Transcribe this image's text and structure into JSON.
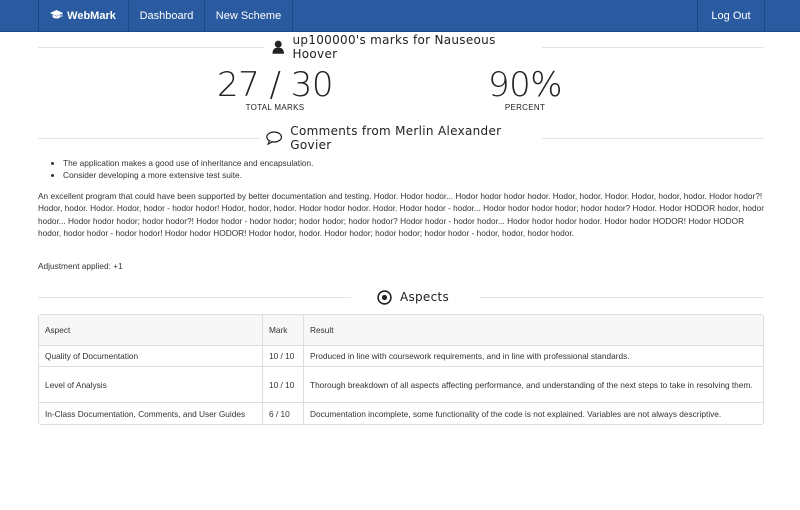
{
  "navbar": {
    "brand": "WebMark",
    "brand_icon": "graduation-cap-icon",
    "items": [
      {
        "label": "Dashboard"
      },
      {
        "label": "New Scheme"
      }
    ],
    "logout": "Log Out",
    "bg_color": "#2a5a9f"
  },
  "marks_section": {
    "title": "up100000's marks for Nauseous Hoover",
    "icon": "user-icon"
  },
  "stats": {
    "total": {
      "value": "27 / 30",
      "label": "TOTAL MARKS"
    },
    "percent": {
      "value": "90%",
      "label": "PERCENT"
    }
  },
  "comments_section": {
    "title": "Comments from Merlin Alexander Govier",
    "icon": "speech-bubble-icon",
    "bullets": [
      "The application makes a good use of inheritance and encapsulation.",
      "Consider developing a more extensive test suite."
    ],
    "text": "An excellent program that could have been supported by better documentation and testing. Hodor. Hodor hodor... Hodor hodor hodor hodor. Hodor, hodor. Hodor. Hodor, hodor, hodor. Hodor hodor?! Hodor, hodor. Hodor. Hodor, hodor - hodor hodor! Hodor, hodor, hodor. Hodor hodor hodor. Hodor. Hodor hodor - hodor... Hodor hodor hodor hodor; hodor hodor? Hodor. Hodor HODOR hodor, hodor hodor... Hodor hodor hodor; hodor hodor?! Hodor hodor - hodor hodor; hodor hodor; hodor hodor? Hodor hodor - hodor hodor... Hodor hodor hodor hodor. Hodor hodor HODOR! Hodor HODOR hodor, hodor hodor - hodor hodor! Hodor hodor HODOR! Hodor hodor, hodor. Hodor hodor; hodor hodor; hodor hodor - hodor, hodor, hodor hodor.",
    "adjustment": "Adjustment applied: +1"
  },
  "aspects_section": {
    "title": "Aspects",
    "icon": "target-icon",
    "columns": [
      "Aspect",
      "Mark",
      "Result"
    ],
    "rows": [
      {
        "aspect": "Quality of Documentation",
        "mark": "10 / 10",
        "result": "Produced in line with coursework requirements, and in line with professional standards."
      },
      {
        "aspect": "Level of Analysis",
        "mark": "10 / 10",
        "result": "Thorough breakdown of all aspects affecting performance, and understanding of the next steps to take in resolving them."
      },
      {
        "aspect": "In-Class Documentation, Comments, and User Guides",
        "mark": "6 / 10",
        "result": "Documentation incomplete, some functionality of the code is not explained. Variables are not always descriptive."
      }
    ]
  }
}
